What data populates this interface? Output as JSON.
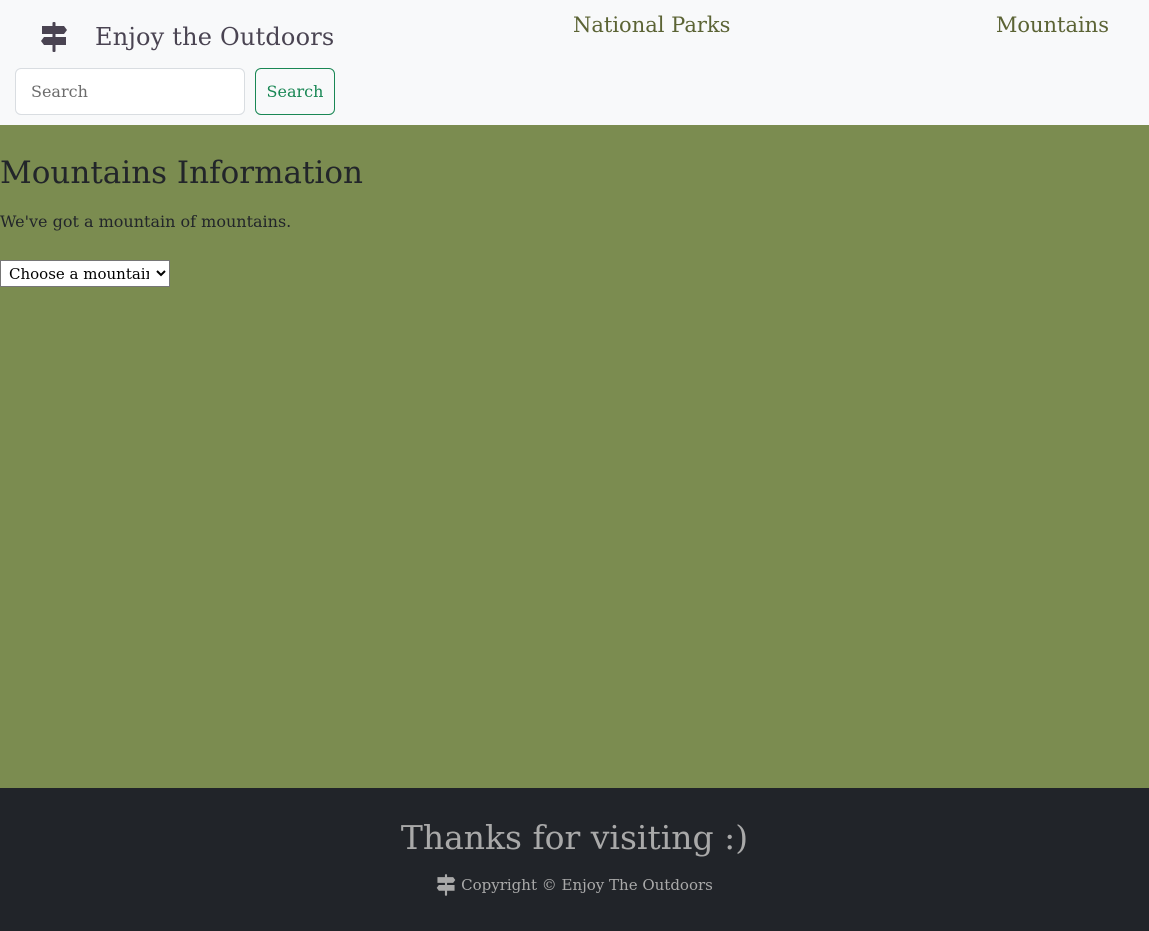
{
  "navbar": {
    "brand_icon": "signpost-icon",
    "brand_text": "Enjoy the Outdoors",
    "links": [
      {
        "label": "National Parks"
      },
      {
        "label": "Mountains"
      }
    ],
    "search": {
      "placeholder": "Search",
      "value": "",
      "button_label": "Search"
    }
  },
  "main": {
    "title": "Mountains Information",
    "subtitle": "We've got a mountain of mountains.",
    "select": {
      "selected": "Choose a mountain"
    }
  },
  "footer": {
    "title": "Thanks for visiting :)",
    "icon": "signpost-icon",
    "copyright": "Copyright © Enjoy The Outdoors"
  },
  "colors": {
    "navbar_bg": "#f8f9fa",
    "main_bg": "#7b8c50",
    "footer_bg": "#212429",
    "nav_link": "#5b6334",
    "search_button_accent": "#198754"
  }
}
